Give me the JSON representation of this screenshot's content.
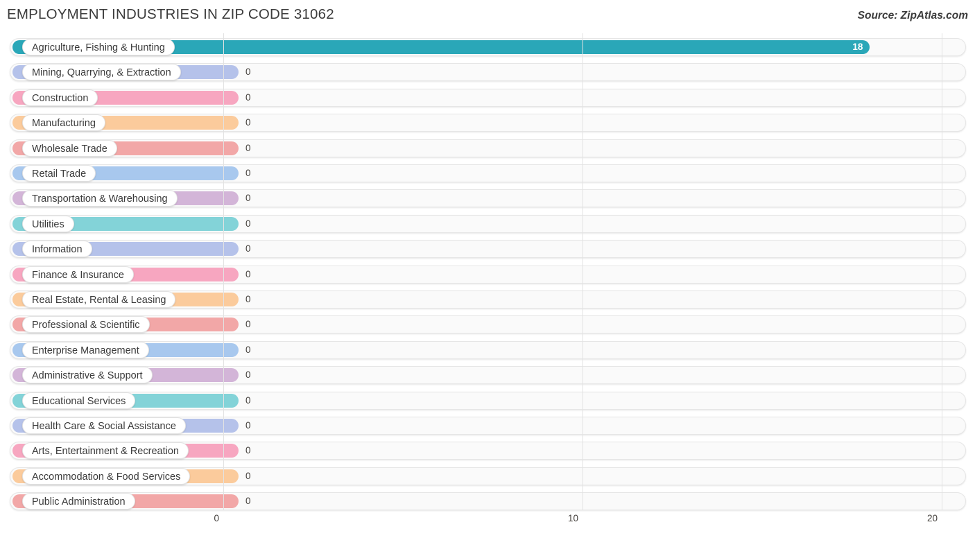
{
  "header": {
    "title": "EMPLOYMENT INDUSTRIES IN ZIP CODE 31062",
    "source": "Source: ZipAtlas.com"
  },
  "chart_data": {
    "type": "bar",
    "orientation": "horizontal",
    "title": "EMPLOYMENT INDUSTRIES IN ZIP CODE 31062",
    "xlabel": "",
    "ylabel": "",
    "xlim": [
      0,
      20
    ],
    "grid": true,
    "legend": "none",
    "ticks": [
      {
        "label": "0",
        "value": 0
      },
      {
        "label": "10",
        "value": 10
      },
      {
        "label": "20",
        "value": 20
      }
    ],
    "categories": [
      "Agriculture, Fishing & Hunting",
      "Mining, Quarrying, & Extraction",
      "Construction",
      "Manufacturing",
      "Wholesale Trade",
      "Retail Trade",
      "Transportation & Warehousing",
      "Utilities",
      "Information",
      "Finance & Insurance",
      "Real Estate, Rental & Leasing",
      "Professional & Scientific",
      "Enterprise Management",
      "Administrative & Support",
      "Educational Services",
      "Health Care & Social Assistance",
      "Arts, Entertainment & Recreation",
      "Accommodation & Food Services",
      "Public Administration"
    ],
    "values": [
      18,
      0,
      0,
      0,
      0,
      0,
      0,
      0,
      0,
      0,
      0,
      0,
      0,
      0,
      0,
      0,
      0,
      0,
      0
    ],
    "value_labels": [
      "18",
      "0",
      "0",
      "0",
      "0",
      "0",
      "0",
      "0",
      "0",
      "0",
      "0",
      "0",
      "0",
      "0",
      "0",
      "0",
      "0",
      "0",
      "0"
    ],
    "colors": [
      "#2aa7b8",
      "#b5c2ea",
      "#f7a6c0",
      "#fbcb9c",
      "#f2a7a7",
      "#a8c8ee",
      "#d3b5d8",
      "#83d3d8",
      "#b5c2ea",
      "#f7a6c0",
      "#fbcb9c",
      "#f2a7a7",
      "#a8c8ee",
      "#d3b5d8",
      "#83d3d8",
      "#b5c2ea",
      "#f7a6c0",
      "#fbcb9c",
      "#f2a7a7"
    ]
  }
}
